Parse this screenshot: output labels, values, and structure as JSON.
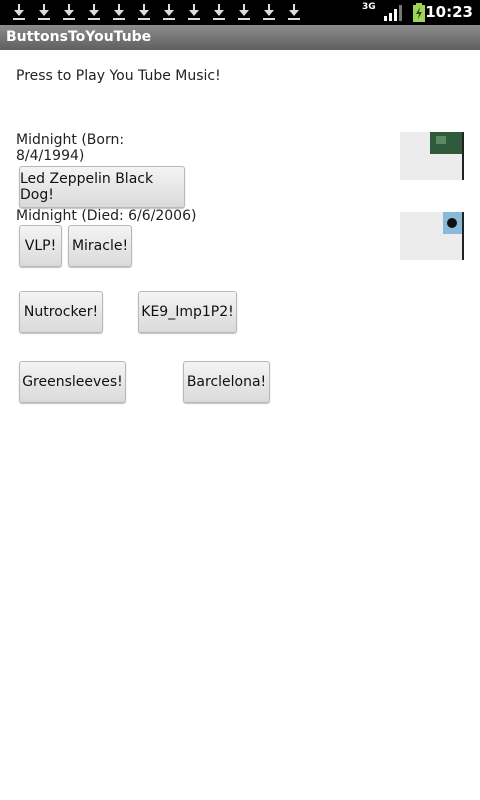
{
  "status_bar": {
    "download_icon_count": 12,
    "network_label": "3G",
    "clock": "10:23"
  },
  "app": {
    "title": "ButtonsToYouTube"
  },
  "content": {
    "intro_text": "Press to Play You Tube Music!",
    "born_label": "Midnight (Born:\n8/4/1994)",
    "died_label": "Midnight (Died: 6/6/2006)",
    "buttons": {
      "led_zeppelin": "Led Zeppelin Black Dog!",
      "vlp": "VLP!",
      "miracle": "Miracle!",
      "nutrocker": "Nutrocker!",
      "ke9": "KE9_Imp1P2!",
      "greensleeves": "Greensleeves!",
      "barcelona": "Barclelona!"
    }
  }
}
